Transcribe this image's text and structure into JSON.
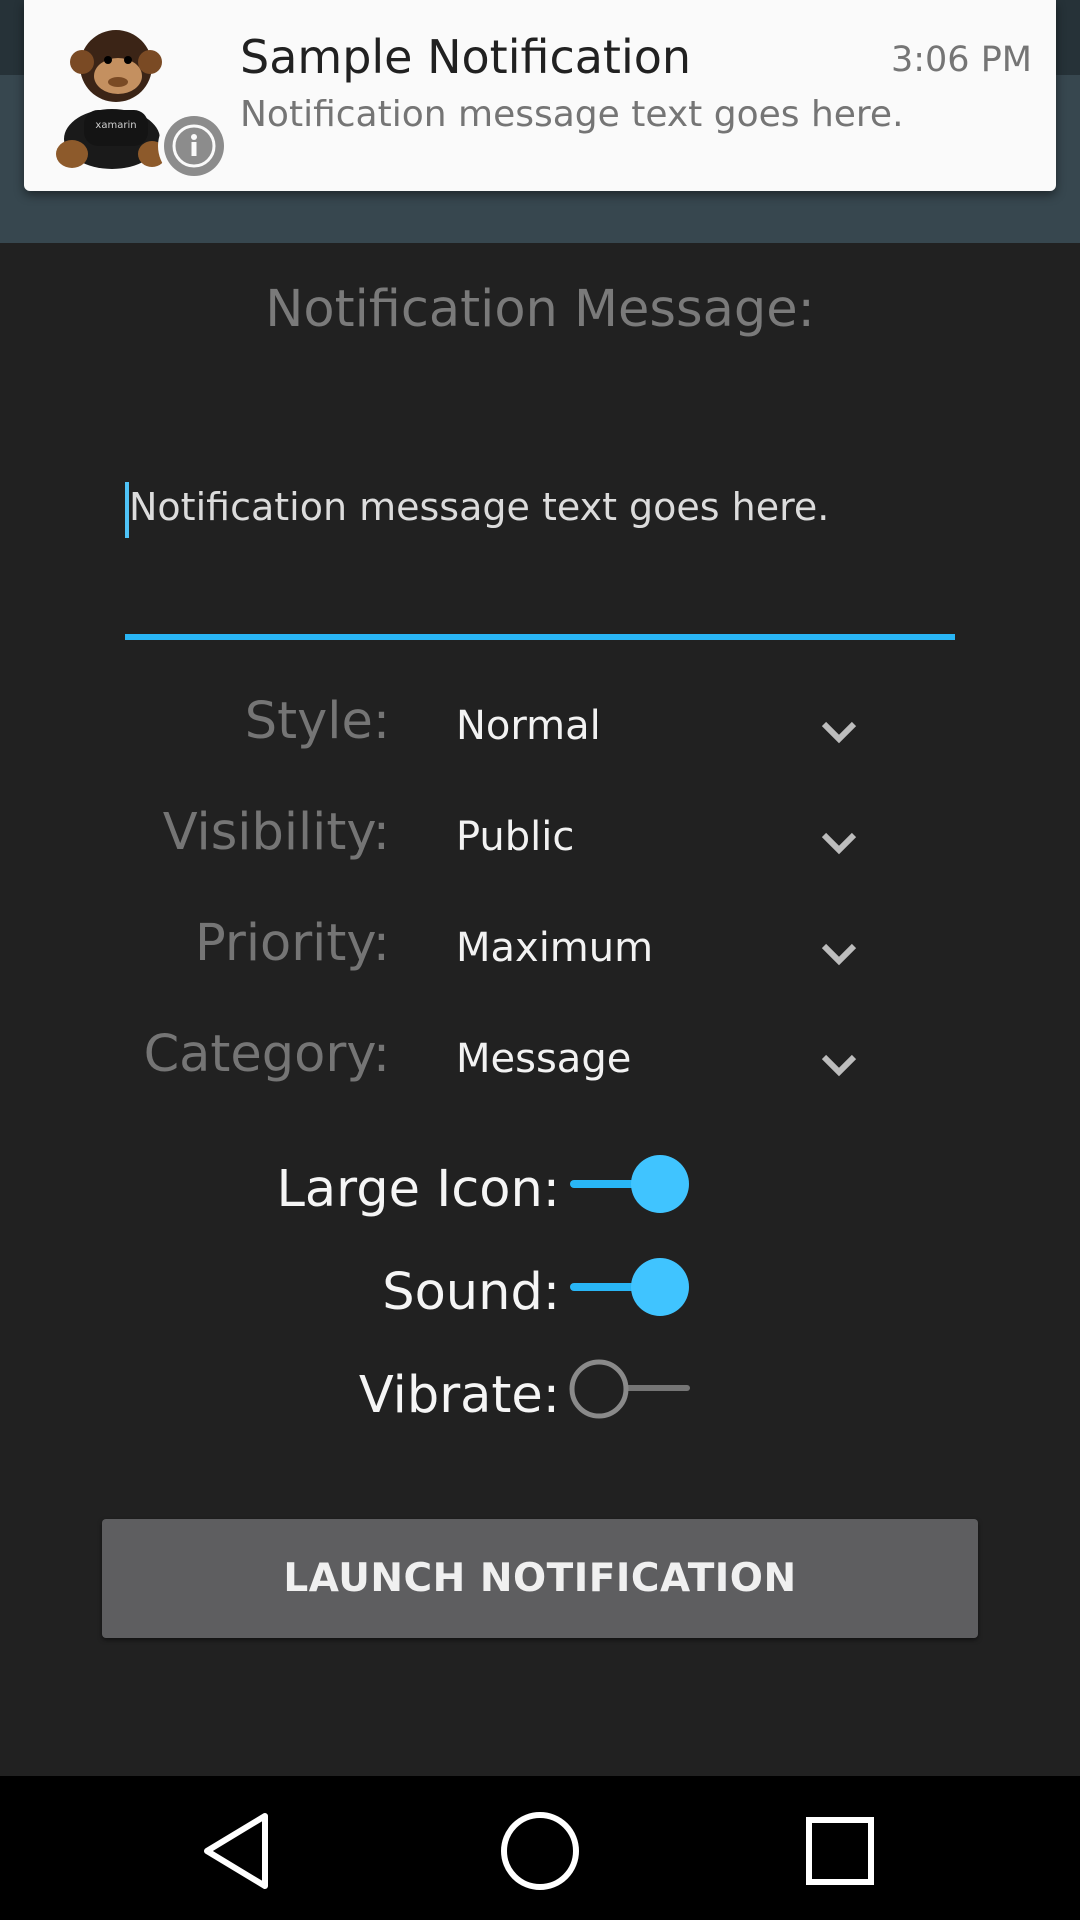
{
  "notification": {
    "title": "Sample Notification",
    "time": "3:06 PM",
    "text": "Notification message text goes here.",
    "large_icon": "monkey-plush-icon",
    "small_icon": "info-icon"
  },
  "form": {
    "heading": "Notification Message:",
    "message_value": "Notification message text goes here.",
    "rows": [
      {
        "label": "Style:",
        "value": "Normal"
      },
      {
        "label": "Visibility:",
        "value": "Public"
      },
      {
        "label": "Priority:",
        "value": "Maximum"
      },
      {
        "label": "Category:",
        "value": "Message"
      }
    ],
    "switches": [
      {
        "label": "Large Icon:",
        "on": true
      },
      {
        "label": "Sound:",
        "on": true
      },
      {
        "label": "Vibrate:",
        "on": false
      }
    ],
    "launch_label": "LAUNCH NOTIFICATION"
  },
  "navigation": {
    "back_icon": "back-triangle-icon",
    "home_icon": "home-circle-icon",
    "recents_icon": "recents-square-icon"
  },
  "colors": {
    "accent": "#29b6f6",
    "background": "#212121",
    "toolbar": "#37474f"
  }
}
